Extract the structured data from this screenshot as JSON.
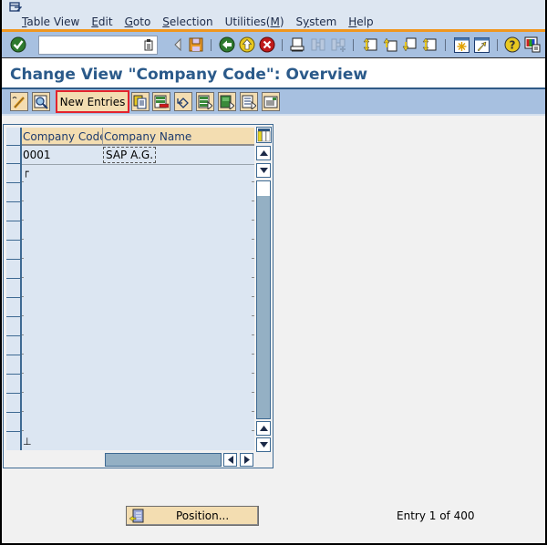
{
  "menubar": {
    "items": [
      {
        "label": "Table View",
        "mnemonic": "T"
      },
      {
        "label": "Edit",
        "mnemonic": "E"
      },
      {
        "label": "Goto",
        "mnemonic": "G"
      },
      {
        "label": "Selection",
        "mnemonic": "S"
      },
      {
        "label": "Utilities(M)",
        "mnemonic": "M"
      },
      {
        "label": "System",
        "mnemonic": "y"
      },
      {
        "label": "Help",
        "mnemonic": "H"
      }
    ]
  },
  "system_toolbar": {
    "command_field": {
      "value": "",
      "placeholder": ""
    },
    "icons": [
      "enter-icon",
      "command-history-icon",
      "back-arrow-icon",
      "save-icon",
      "back-icon",
      "exit-icon",
      "cancel-icon",
      "print-icon",
      "find-icon",
      "find-next-icon",
      "first-page-icon",
      "previous-page-icon",
      "next-page-icon",
      "last-page-icon",
      "new-session-icon",
      "create-shortcut-icon",
      "help-icon",
      "customize-layout-icon"
    ]
  },
  "title": "Change View \"Company Code\": Overview",
  "app_toolbar": {
    "new_entries_label": "New Entries",
    "icons": [
      "display-change-icon",
      "details-icon",
      "copy-as-icon",
      "delete-icon",
      "undo-change-icon",
      "select-all-icon",
      "select-block-icon",
      "deselect-all-icon",
      "print-field-list-icon"
    ]
  },
  "table": {
    "columns": [
      "Company Code",
      "Company Name"
    ],
    "rows": [
      {
        "company_code": "0001",
        "company_name": "SAP A.G."
      }
    ],
    "visible_row_count": 16
  },
  "footer": {
    "position_button_label": "Position...",
    "entry_status": "Entry 1 of 400"
  },
  "colors": {
    "menubar_bg": "#dde6f1",
    "toolbar_bg": "#a7c0e0",
    "accent_orange": "#f0961e",
    "title_blue": "#2b5a8a",
    "button_bg": "#f3ddb1",
    "highlight_red": "#e3222c",
    "table_bg": "#dce6f2"
  }
}
